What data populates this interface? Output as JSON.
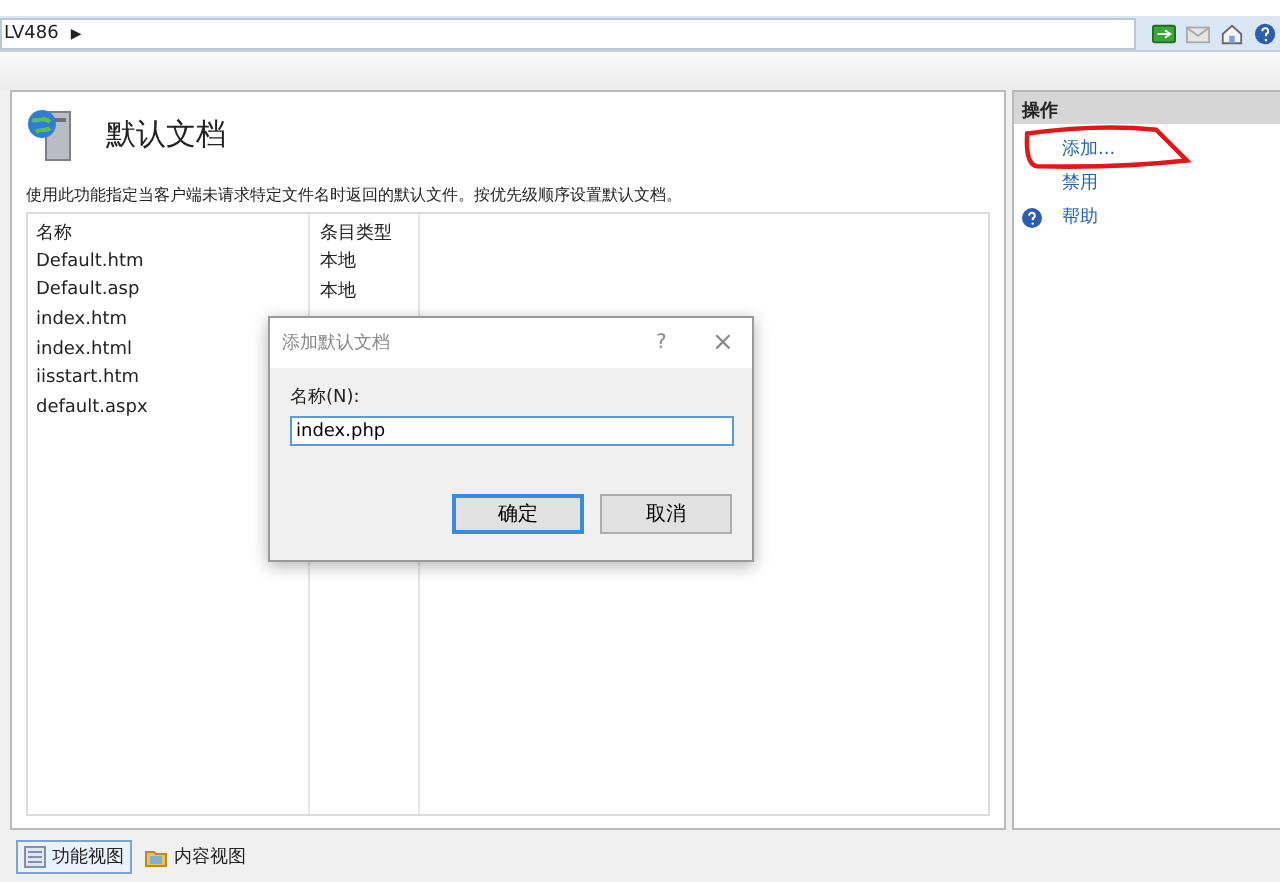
{
  "address_bar": {
    "path": "LV486",
    "separator": "▶"
  },
  "page": {
    "title": "默认文档",
    "description": "使用此功能指定当客户端未请求特定文件名时返回的默认文件。按优先级顺序设置默认文档。",
    "columns": [
      "名称",
      "条目类型"
    ],
    "rows": [
      {
        "name": "Default.htm",
        "type": "本地"
      },
      {
        "name": "Default.asp",
        "type": "本地"
      },
      {
        "name": "index.htm"
      },
      {
        "name": "index.html"
      },
      {
        "name": "iisstart.htm"
      },
      {
        "name": "default.aspx"
      }
    ]
  },
  "actions": {
    "title": "操作",
    "items": [
      {
        "label": "添加...",
        "kind": "link",
        "circled": true
      },
      {
        "label": "禁用",
        "kind": "link",
        "circled": false
      },
      {
        "label": "帮助",
        "kind": "help",
        "circled": false
      }
    ]
  },
  "view_tabs": [
    {
      "label": "功能视图",
      "selected": true
    },
    {
      "label": "内容视图",
      "selected": false
    }
  ],
  "dialog": {
    "title": "添加默认文档",
    "help": "?",
    "close": "×",
    "field_label": "名称(N):",
    "value": "index.php",
    "buttons": [
      {
        "label": "确定",
        "default": true
      },
      {
        "label": "取消",
        "default": false
      }
    ]
  }
}
